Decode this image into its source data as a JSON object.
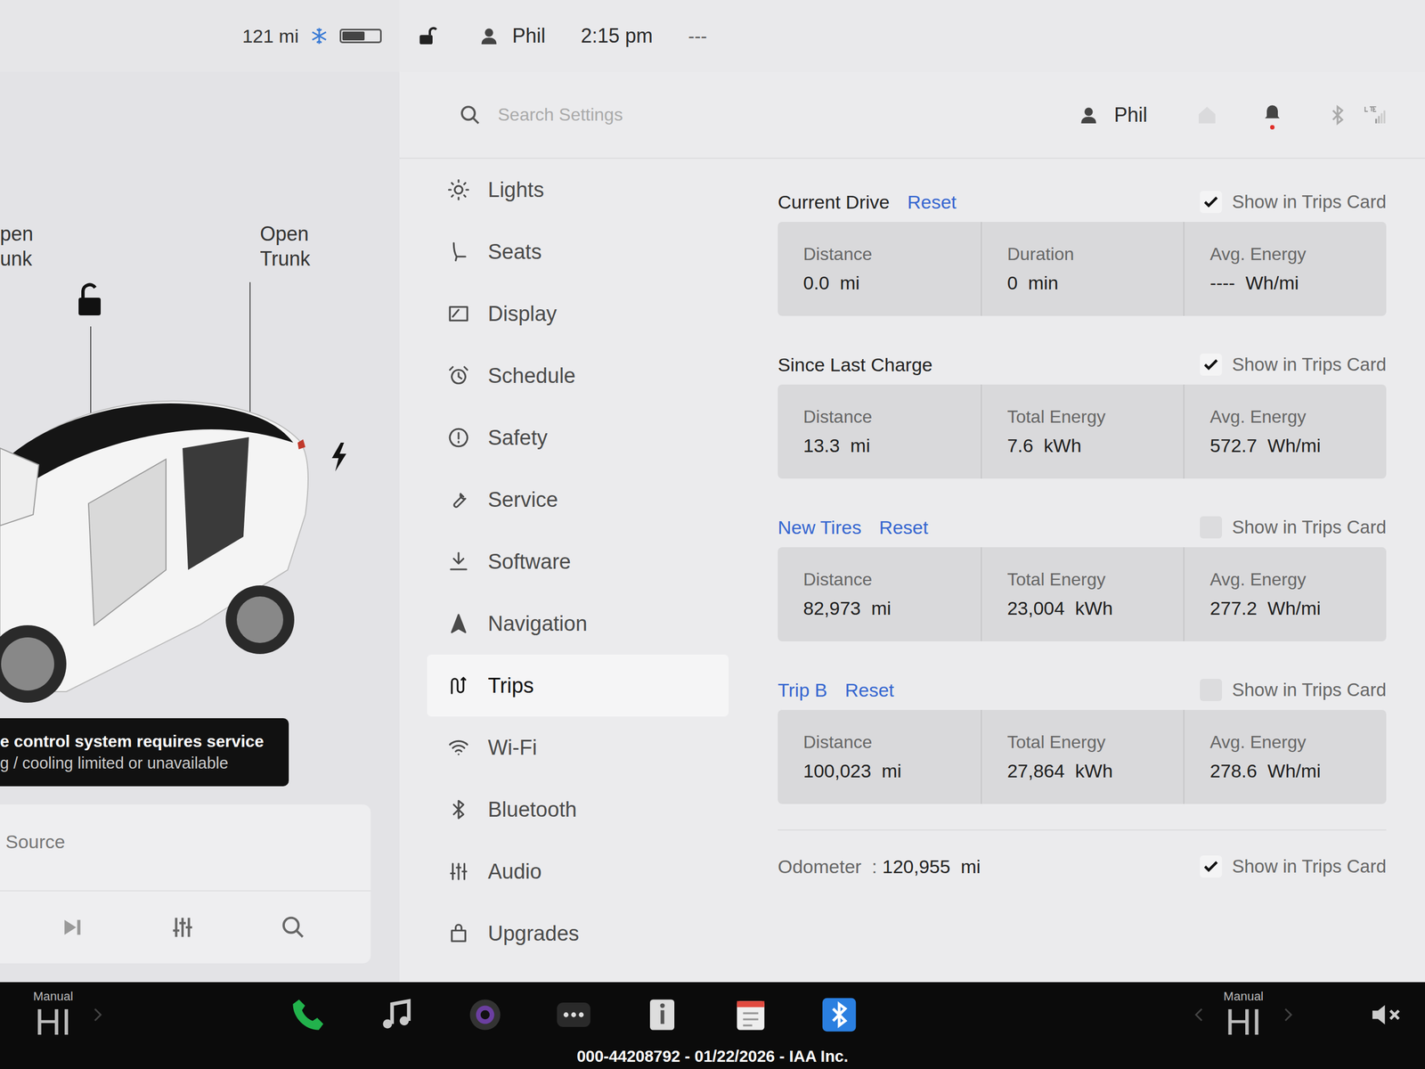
{
  "status_bar": {
    "range": "121 mi",
    "battery_level": 0.6,
    "user": "Phil",
    "time": "2:15 pm",
    "extra": "---"
  },
  "car_panel": {
    "frunk_label": [
      "pen",
      "unk"
    ],
    "trunk_label": [
      "Open",
      "Trunk"
    ],
    "alert": [
      "e control system requires service",
      "g / cooling limited or unavailable"
    ]
  },
  "media": {
    "source": "Source"
  },
  "settings_header": {
    "search_placeholder": "Search Settings",
    "user": "Phil"
  },
  "nav": [
    {
      "label": "Lights",
      "selected": false
    },
    {
      "label": "Seats",
      "selected": false
    },
    {
      "label": "Display",
      "selected": false
    },
    {
      "label": "Schedule",
      "selected": false
    },
    {
      "label": "Safety",
      "selected": false
    },
    {
      "label": "Service",
      "selected": false
    },
    {
      "label": "Software",
      "selected": false
    },
    {
      "label": "Navigation",
      "selected": false
    },
    {
      "label": "Trips",
      "selected": true
    },
    {
      "label": "Wi-Fi",
      "selected": false
    },
    {
      "label": "Bluetooth",
      "selected": false
    },
    {
      "label": "Audio",
      "selected": false
    },
    {
      "label": "Upgrades",
      "selected": false
    }
  ],
  "trips": [
    {
      "title": "Current Drive",
      "title_link": false,
      "reset": "Reset",
      "show_label": "Show in Trips Card",
      "show": true,
      "stats": [
        {
          "label": "Distance",
          "value": "0.0  mi"
        },
        {
          "label": "Duration",
          "value": "0  min"
        },
        {
          "label": "Avg. Energy",
          "value": "----  Wh/mi"
        }
      ]
    },
    {
      "title": "Since Last Charge",
      "title_link": false,
      "reset": "",
      "show_label": "Show in Trips Card",
      "show": true,
      "stats": [
        {
          "label": "Distance",
          "value": "13.3  mi"
        },
        {
          "label": "Total Energy",
          "value": "7.6  kWh"
        },
        {
          "label": "Avg. Energy",
          "value": "572.7  Wh/mi"
        }
      ]
    },
    {
      "title": "New Tires",
      "title_link": true,
      "reset": "Reset",
      "show_label": "Show in Trips Card",
      "show": false,
      "stats": [
        {
          "label": "Distance",
          "value": "82,973  mi"
        },
        {
          "label": "Total Energy",
          "value": "23,004  kWh"
        },
        {
          "label": "Avg. Energy",
          "value": "277.2  Wh/mi"
        }
      ]
    },
    {
      "title": "Trip B",
      "title_link": true,
      "reset": "Reset",
      "show_label": "Show in Trips Card",
      "show": false,
      "stats": [
        {
          "label": "Distance",
          "value": "100,023  mi"
        },
        {
          "label": "Total Energy",
          "value": "27,864  kWh"
        },
        {
          "label": "Avg. Energy",
          "value": "278.6  Wh/mi"
        }
      ]
    }
  ],
  "odometer": {
    "label": "Odometer  :",
    "value": "120,955  mi",
    "show_label": "Show in Trips Card",
    "show": true
  },
  "dock": {
    "left": {
      "mode": "Manual",
      "temp": "HI"
    },
    "right": {
      "mode": "Manual",
      "temp": "HI"
    }
  },
  "watermark": "000-44208792 - 01/22/2026 - IAA Inc."
}
